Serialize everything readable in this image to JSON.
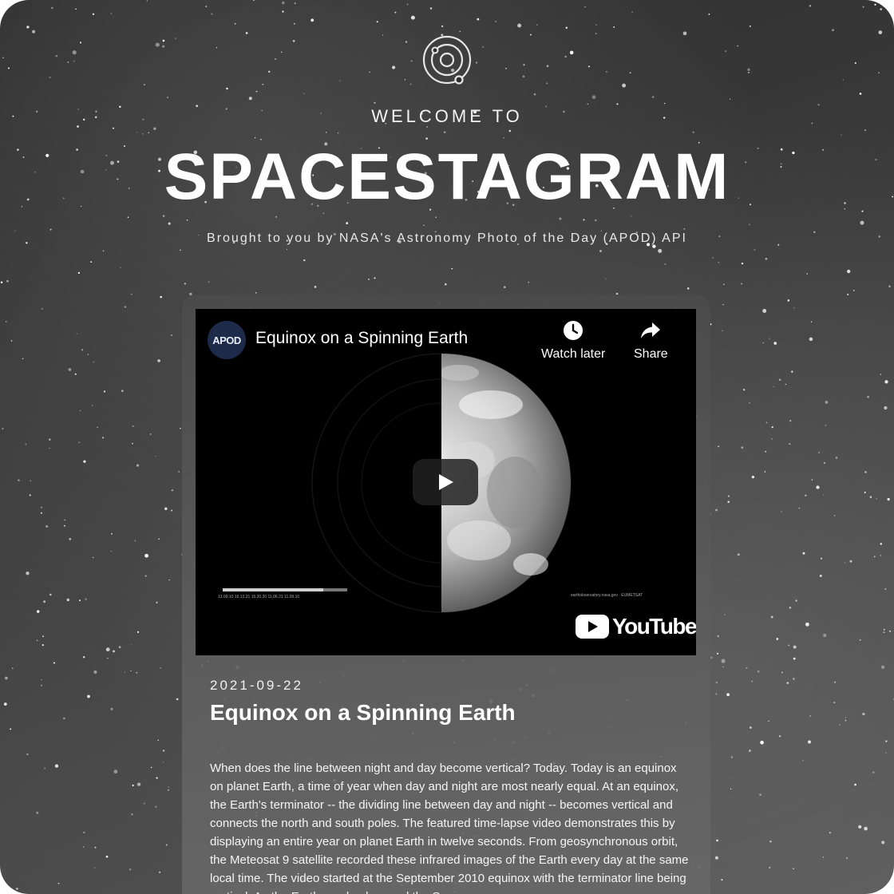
{
  "header": {
    "logo_icon": "solar-system-icon",
    "welcome": "WELCOME TO",
    "title": "SPACESTAGRAM",
    "subtitle": "Brought to you by NASA's Astronomy Photo of the Day (APOD) API"
  },
  "post": {
    "video": {
      "channel_avatar_text": "APOD",
      "title": "Equinox on a Spinning Earth",
      "watch_later_label": "Watch later",
      "share_label": "Share",
      "youtube_label": "YouTube"
    },
    "date": "2021-09-22",
    "title": "Equinox on a Spinning Earth",
    "explanation": "When does the line between night and day become vertical? Today. Today is an equinox on planet Earth, a time of year when day and night are most nearly equal. At an equinox, the Earth's terminator -- the dividing line between day and night -- becomes vertical and connects the north and south poles. The featured time-lapse video demonstrates this by displaying an entire year on planet Earth in twelve seconds. From geosynchronous orbit, the Meteosat 9 satellite recorded these infrared images of the Earth every day at the same local time. The video started at the September 2010 equinox with the terminator line being vertical. As the Earth revolved around the Sun,"
  },
  "colors": {
    "background": "#3a3a3a",
    "card": "#5a5a5a",
    "video_bg": "#000000",
    "text": "#ffffff"
  }
}
